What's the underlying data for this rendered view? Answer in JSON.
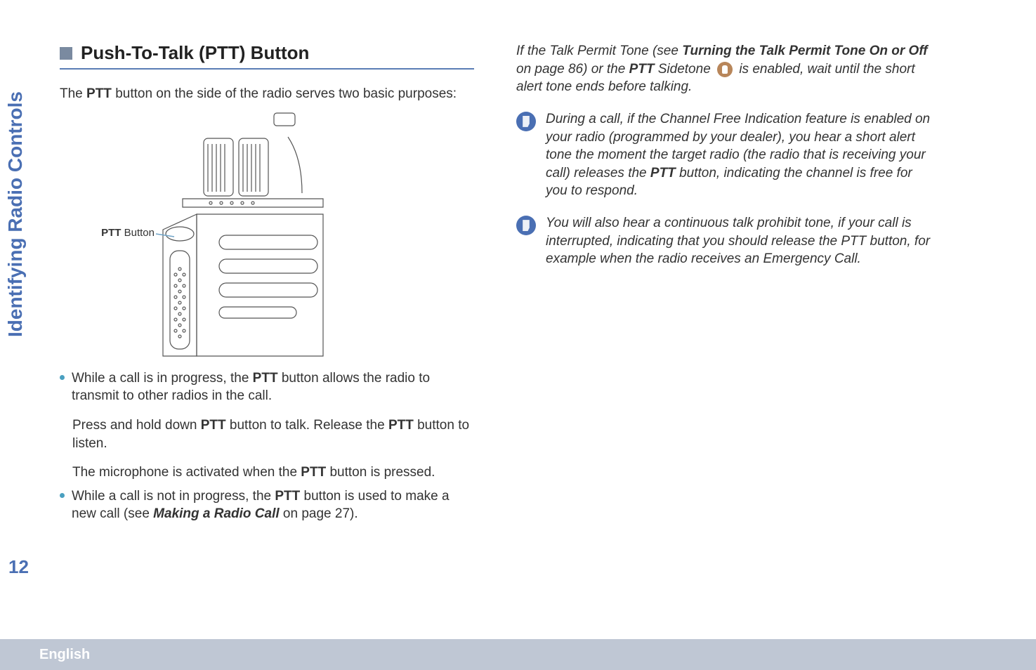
{
  "sidebar": {
    "label": "Identifying Radio Controls"
  },
  "page_number": "12",
  "footer": {
    "language": "English"
  },
  "left": {
    "section_title": "Push-To-Talk (PTT) Button",
    "intro_pre": "The ",
    "intro_bold": "PTT",
    "intro_post": " button on the side of the radio serves two basic purposes:",
    "figure_caption_bold": "PTT",
    "figure_caption_rest": " Button",
    "bullet1_a": "While a call is in progress, the ",
    "bullet1_b": "PTT",
    "bullet1_c": " button allows the radio to transmit to other radios in the call.",
    "para2_a": "Press and hold down ",
    "para2_b": "PTT",
    "para2_c": " button to talk. Release the ",
    "para2_d": "PTT",
    "para2_e": " button to listen.",
    "para3_a": "The microphone is activated when the ",
    "para3_b": "PTT",
    "para3_c": " button is pressed.",
    "bullet2_a": "While a call is not in progress, the ",
    "bullet2_b": "PTT",
    "bullet2_c": " button is used to make a new call (see ",
    "bullet2_d": "Making a Radio Call",
    "bullet2_e": " on page 27)."
  },
  "right": {
    "p1_a": "If the Talk Permit Tone (see ",
    "p1_b": "Turning the Talk Permit Tone On or Off",
    "p1_c": " on page 86) or the ",
    "p1_d": "PTT",
    "p1_e": " Sidetone ",
    "p1_f": "  is enabled, wait until the short alert tone ends before talking.",
    "note1_a": "During a call, if the Channel Free Indication feature is enabled on your radio (programmed by your dealer), you hear a short alert tone the moment the target radio (the radio that is receiving your call) releases the ",
    "note1_b": "PTT",
    "note1_c": " button, indicating the channel is free for you to respond.",
    "note2": "You will also hear a continuous talk prohibit tone, if your call is interrupted, indicating that you should release the PTT button, for example when the radio receives an Emergency Call."
  }
}
